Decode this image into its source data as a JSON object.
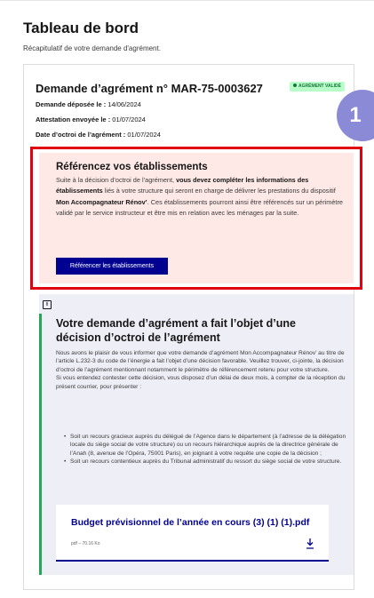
{
  "header": {
    "title": "Tableau de bord",
    "subtitle": "Récapitulatif de votre demande d'agrément."
  },
  "request": {
    "title": "Demande d’agrément n° MAR-75-0003627",
    "status_badge": "AGRÉMENT VALIDÉ",
    "status_color": "#18753c",
    "deposit_label": "Demande déposée le :",
    "deposit_value": "14/06/2024",
    "attestation_label": "Attestation envoyée le :",
    "attestation_value": "01/07/2024",
    "grant_label": "Date d’octroi de l’agrément :",
    "grant_value": "01/07/2024"
  },
  "step_marker": "1",
  "reference": {
    "title": "Référencez vos établissements",
    "text_1": "Suite à la décision d’octroi de l’agrément, ",
    "text_2": "vous devez compléter les informations des établissements",
    "text_3": " liés à votre structure qui seront en charge de délivrer les prestations du dispositif ",
    "text_4": "Mon Accompagnateur Rénov’",
    "text_5": ". Ces établissements pourront ainsi être référencés sur un périmètre validé par le service instructeur et être mis en relation avec les ménages par la suite.",
    "button_label": "Référencer les établissements"
  },
  "decision": {
    "title": "Votre demande d’agrément a fait l’objet d’une décision d’octroi de l’agrément",
    "paragraph_1": "Nous avons le plaisir de vous informer que votre demande d’agrément Mon Accompagnateur Rénov’ au titre de l’article L.232-3 du code de l’énergie a fait l’objet d’une décision favorable. Veuillez trouver, ci-jointe, la décision d’octroi de l’agrément mentionnant notamment le périmètre de référencement retenu pour votre structure.",
    "paragraph_2": "Si vous entendez contester cette décision, vous disposez d’un délai de deux mois, à compter de la réception du présent courrier, pour présenter :",
    "bullets": [
      "Soit un recours gracieux auprès du délégué de l’Agence dans le département (à l’adresse de la délégation locale du siège social de votre structure) ou un recours hiérarchique auprès de la directrice générale de l’Anah (8, avenue de l’Opéra, 75001 Paris), en joignant à votre requête une copie de la décision ;",
      "Soit un recours contentieux auprès du Tribunal administratif du ressort du siège social de votre structure."
    ]
  },
  "document": {
    "title": "Budget prévisionnel de l’année en cours (3) (1) (1).pdf",
    "meta": "pdf – 70.16 Ko",
    "icon": "download-icon",
    "accent_color": "#000091"
  }
}
